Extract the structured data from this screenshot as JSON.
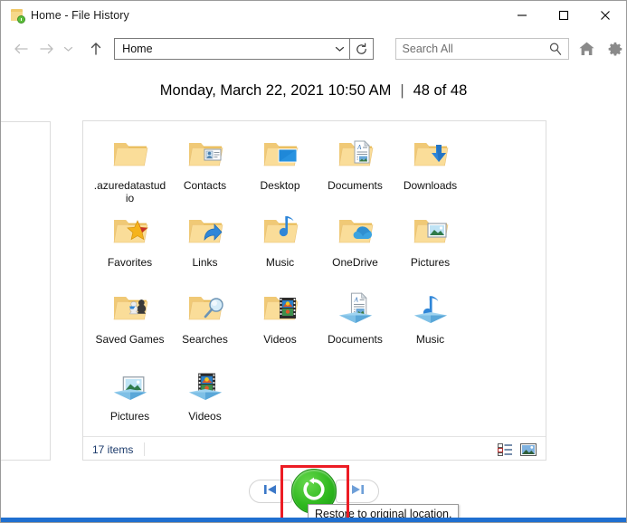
{
  "window": {
    "title": "Home - File History",
    "title_icon": "folder-clock-icon",
    "minimize_label": "—",
    "maximize_label": "□",
    "close_label": "✕"
  },
  "navbar": {
    "back_icon": "back-arrow-icon",
    "forward_icon": "forward-arrow-icon",
    "history_icon": "chevron-down-icon",
    "up_icon": "up-arrow-icon",
    "address_value": "Home",
    "address_chevron_icon": "chevron-down-icon",
    "refresh_icon": "refresh-icon",
    "search_placeholder": "Search All",
    "search_value": "",
    "search_icon": "search-icon",
    "home_icon": "home-icon",
    "settings_icon": "gear-icon"
  },
  "header": {
    "timestamp": "Monday, March 22, 2021 10:50 AM",
    "separator": "|",
    "version_counter": "48 of 48"
  },
  "items": [
    {
      "label": ".azuredatastudio",
      "icon": "folder-plain-icon"
    },
    {
      "label": "Contacts",
      "icon": "folder-contacts-icon"
    },
    {
      "label": "Desktop",
      "icon": "folder-desktop-icon"
    },
    {
      "label": "Documents",
      "icon": "folder-documents-icon"
    },
    {
      "label": "Downloads",
      "icon": "folder-downloads-icon"
    },
    {
      "label": "Favorites",
      "icon": "folder-favorites-icon"
    },
    {
      "label": "Links",
      "icon": "folder-links-icon"
    },
    {
      "label": "Music",
      "icon": "folder-music-icon"
    },
    {
      "label": "OneDrive",
      "icon": "folder-onedrive-icon"
    },
    {
      "label": "Pictures",
      "icon": "folder-pictures-icon"
    },
    {
      "label": "Saved Games",
      "icon": "folder-saved-games-icon"
    },
    {
      "label": "Searches",
      "icon": "folder-searches-icon"
    },
    {
      "label": "Videos",
      "icon": "folder-videos-icon"
    },
    {
      "label": "Documents",
      "icon": "library-documents-icon"
    },
    {
      "label": "Music",
      "icon": "library-music-icon"
    },
    {
      "label": "Pictures",
      "icon": "library-pictures-icon"
    },
    {
      "label": "Videos",
      "icon": "library-videos-icon"
    }
  ],
  "statusbar": {
    "item_count": "17 items",
    "details_view_icon": "details-view-icon",
    "large_icons_view_icon": "large-icons-view-icon"
  },
  "bottomnav": {
    "previous_label": "previous-version-icon",
    "restore_label": "restore-icon",
    "next_label": "next-version-icon",
    "tooltip": "Restore to original location.",
    "highlight_color": "#ec1c24",
    "restore_color": "#2fb81f"
  }
}
